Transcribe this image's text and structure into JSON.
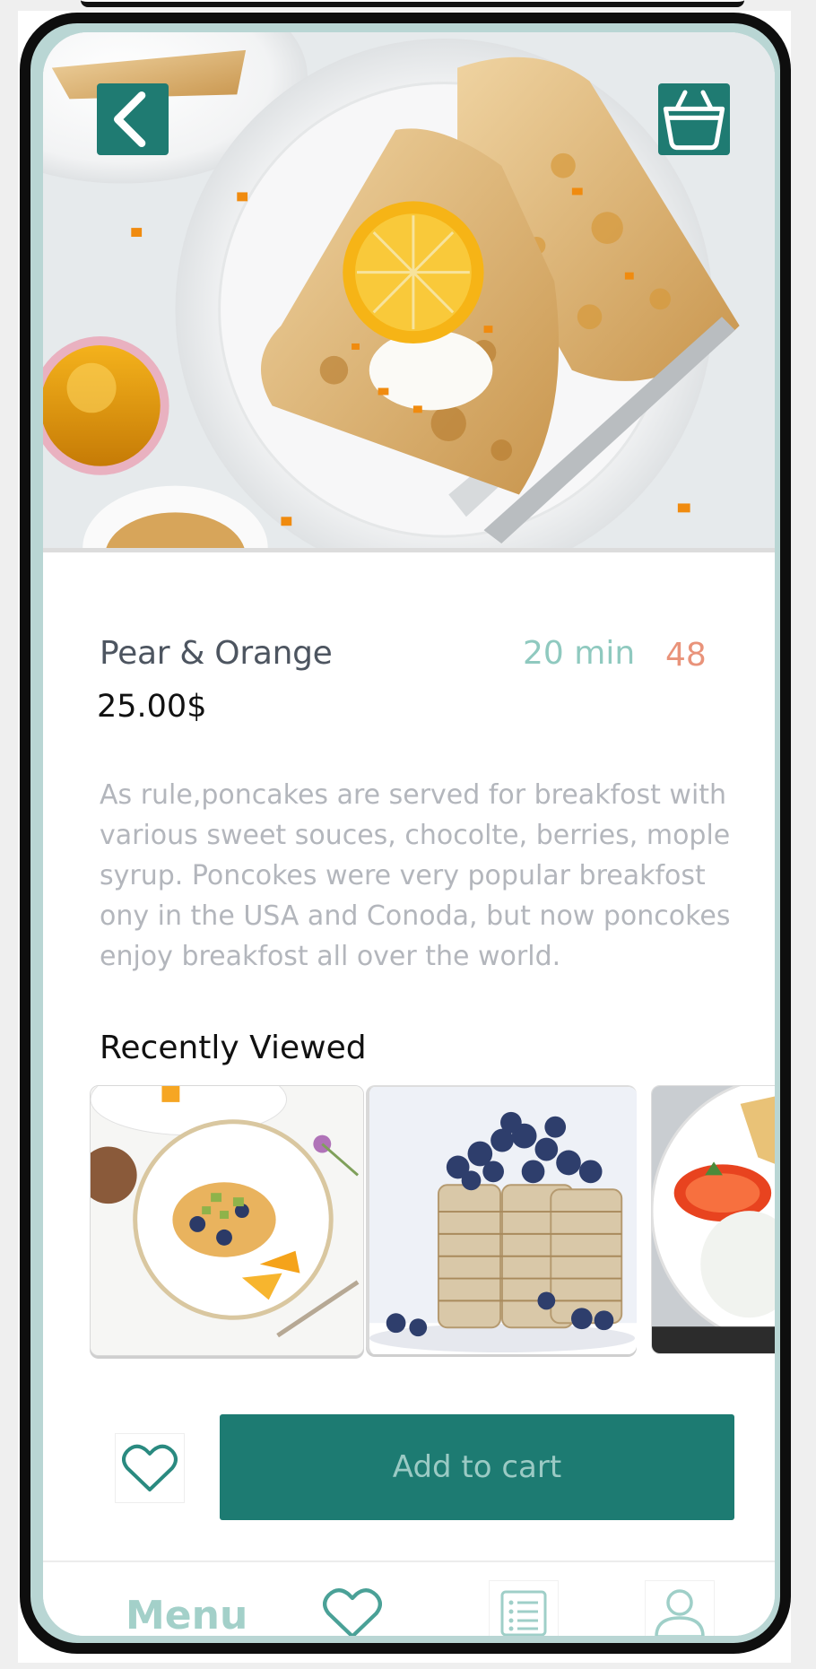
{
  "product": {
    "title": "Pear & Orange",
    "time": "20 min",
    "rating": "48",
    "price": "25.00$",
    "description": "As rule,poncakes are served for breakfost with various sweet souces, chocolte, berries, mople syrup. Poncokes were  very popular breakfost ony in the USA and Conoda, but now poncokes enjoy breakfost all over the world."
  },
  "recently_viewed": {
    "title": "Recently Viewed",
    "items": [
      {
        "icon": "crepe-plate-image"
      },
      {
        "icon": "blueberry-pancake-stack-image"
      },
      {
        "icon": "tomato-plate-image"
      }
    ]
  },
  "actions": {
    "add_to_cart_label": "Add to cart"
  },
  "nav": {
    "menu_label": "Menu"
  },
  "icons": {
    "back": "chevron-left-icon",
    "basket": "basket-icon",
    "favorite": "heart-icon",
    "list": "list-icon",
    "user": "user-icon"
  },
  "colors": {
    "accent": "#1d7b72",
    "time": "#8fc9bf",
    "rating": "#e9937a",
    "nav_menu": "#a3d0c9"
  }
}
